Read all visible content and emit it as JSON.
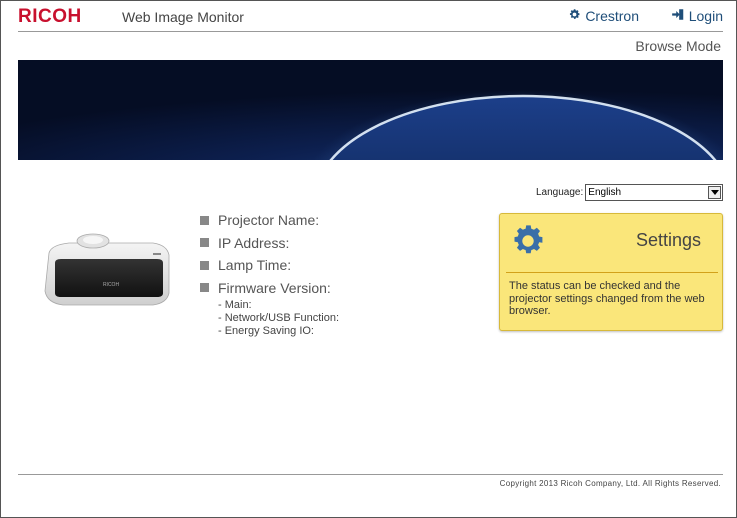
{
  "header": {
    "logo": "RICOH",
    "app_title": "Web Image Monitor",
    "crestron_label": "Crestron",
    "login_label": "Login"
  },
  "mode": "Browse Mode",
  "language": {
    "label": "Language:",
    "selected": "English"
  },
  "device_info": {
    "items": [
      {
        "label": "Projector Name:"
      },
      {
        "label": "IP Address:"
      },
      {
        "label": "Lamp Time:"
      },
      {
        "label": "Firmware Version:"
      }
    ],
    "firmware_sub": [
      "- Main:",
      "- Network/USB Function:",
      "- Energy Saving IO:"
    ]
  },
  "projector_brand": "RICOH",
  "settings_card": {
    "title": "Settings",
    "description": "The status can be checked and the projector settings changed from the web browser."
  },
  "footer": {
    "copyright": "Copyright 2013 Ricoh Company, Ltd. All Rights Reserved."
  },
  "colors": {
    "brand_red": "#c8102e",
    "link_blue": "#1f4e79",
    "card_yellow": "#fae67a",
    "banner_navy": "#0a1a3a"
  },
  "icons": {
    "crestron": "gear-icon",
    "login": "login-icon",
    "settings": "gear-icon"
  }
}
